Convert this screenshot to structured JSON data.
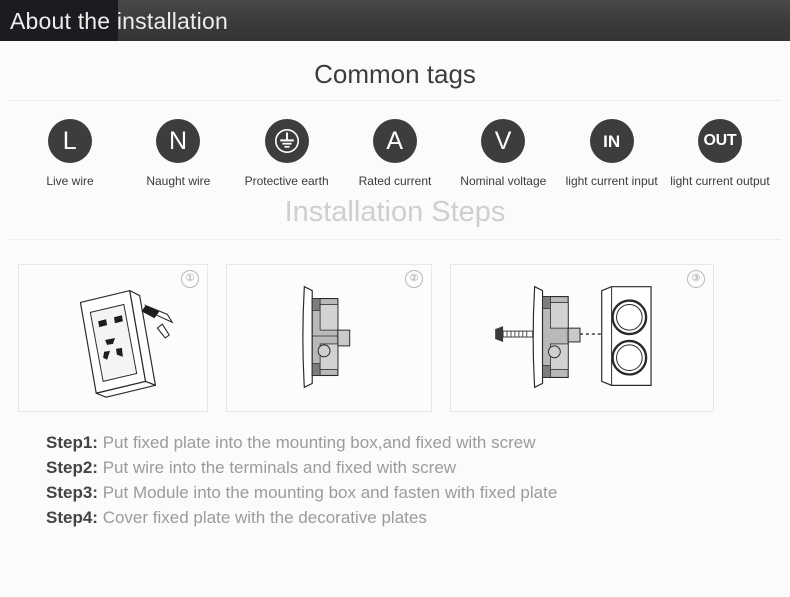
{
  "header": {
    "title": "About the installation"
  },
  "common_tags": {
    "title": "Common tags",
    "items": [
      {
        "glyph": "L",
        "icon": "letter-l-icon",
        "label": "Live wire"
      },
      {
        "glyph": "N",
        "icon": "letter-n-icon",
        "label": "Naught wire"
      },
      {
        "glyph": "",
        "icon": "protective-earth-icon",
        "label": "Protective earth"
      },
      {
        "glyph": "A",
        "icon": "letter-a-icon",
        "label": "Rated current"
      },
      {
        "glyph": "V",
        "icon": "letter-v-icon",
        "label": "Nominal voltage"
      },
      {
        "glyph": "IN",
        "icon": "in-icon",
        "label": "light current input"
      },
      {
        "glyph": "OUT",
        "icon": "out-icon",
        "label": "light current output"
      }
    ]
  },
  "installation": {
    "title": "Installation Steps",
    "panels": [
      {
        "number": "①",
        "art": "socket-faceplate-with-tool"
      },
      {
        "number": "②",
        "art": "socket-module-side-view"
      },
      {
        "number": "③",
        "art": "screw-module-mounting-plate"
      }
    ],
    "steps": [
      {
        "label": "Step1:",
        "text": "Put fixed plate into the mounting box,and fixed with screw"
      },
      {
        "label": "Step2:",
        "text": "Put wire into the terminals and fixed with screw"
      },
      {
        "label": "Step3:",
        "text": "Put Module into the mounting box and fasten with fixed plate"
      },
      {
        "label": "Step4:",
        "text": "Cover fixed plate with the decorative plates"
      }
    ]
  },
  "colors": {
    "header_dark_block": "#1c1c20",
    "header_bar": "#3c3c3c",
    "icon_circle": "#3d3d3d",
    "page_bg": "#fbfbfb",
    "steps_title": "#cfcfcf",
    "step_label": "#444444",
    "step_desc": "#9b9b9b"
  }
}
